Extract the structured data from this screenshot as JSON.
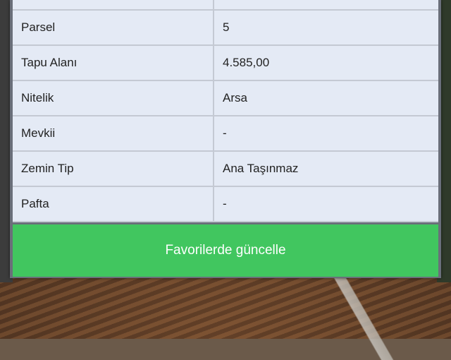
{
  "rows": [
    {
      "key": "",
      "value": ""
    },
    {
      "key": "Parsel",
      "value": "5"
    },
    {
      "key": "Tapu Alanı",
      "value": "4.585,00"
    },
    {
      "key": "Nitelik",
      "value": "Arsa"
    },
    {
      "key": "Mevkii",
      "value": "-"
    },
    {
      "key": "Zemin Tip",
      "value": "Ana Taşınmaz"
    },
    {
      "key": "Pafta",
      "value": "-"
    }
  ],
  "button": {
    "label": "Favorilerde güncelle"
  },
  "colors": {
    "button": "#41c65f",
    "row_bg": "#e4eaf5"
  }
}
